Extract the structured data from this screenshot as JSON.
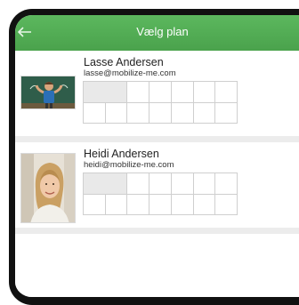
{
  "header": {
    "title": "Vælg plan",
    "back_icon": "arrow-left-icon"
  },
  "colors": {
    "header_green": "#4caf50",
    "separator": "#ececec"
  },
  "users": [
    {
      "name": "Lasse Andersen",
      "email": "lasse@mobilize-me.com",
      "avatar": "boy-chalkboard-photo"
    },
    {
      "name": "Heidi Andersen",
      "email": "heidi@mobilize-me.com",
      "avatar": "woman-portrait-photo"
    }
  ]
}
